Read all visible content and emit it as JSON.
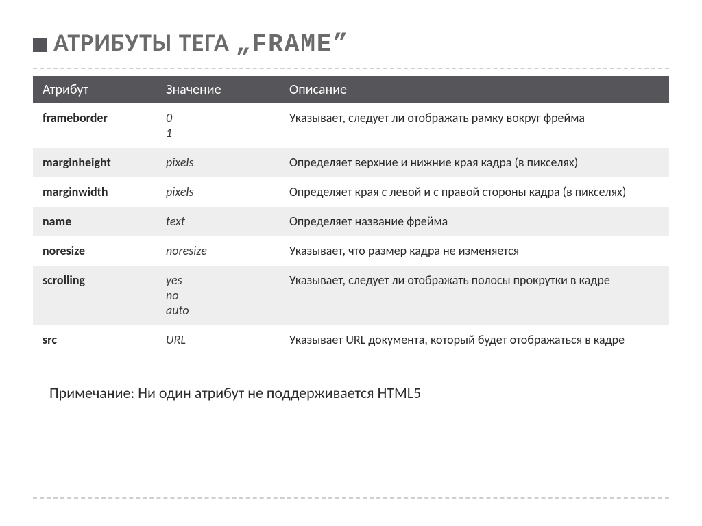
{
  "title_prefix": "АТРИБУТЫ ТЕГА ",
  "title_tag_quoted": "„FRAME”",
  "table": {
    "headers": {
      "attr": "Атрибут",
      "value": "Значение",
      "desc": "Описание"
    },
    "rows": [
      {
        "attr": "frameborder",
        "value": "0\n1",
        "desc": "Указывает, следует  ли отображать рамку вокруг фрейма"
      },
      {
        "attr": "marginheight",
        "value": "pixels",
        "desc": "Определяет верхние и нижние края кадра (в пикселях)"
      },
      {
        "attr": "marginwidth",
        "value": "pixels",
        "desc": "Определяет  края с левой и с правой стороны кадра (в пикселях)"
      },
      {
        "attr": "name",
        "value": "text",
        "desc": "Определяет название фрейма"
      },
      {
        "attr": "noresize",
        "value": "noresize",
        "desc": "Указывает, что размер кадра не изменяется"
      },
      {
        "attr": "scrolling",
        "value": "yes\nno\nauto",
        "desc": "Указывает, следует ли отображать полосы прокрутки в кадре"
      },
      {
        "attr": "src",
        "value": "URL",
        "desc": "Указывает URL документа, который будет отображаться в кадре"
      }
    ]
  },
  "note": "Примечание: Ни один атрибут не поддерживается HTML5"
}
